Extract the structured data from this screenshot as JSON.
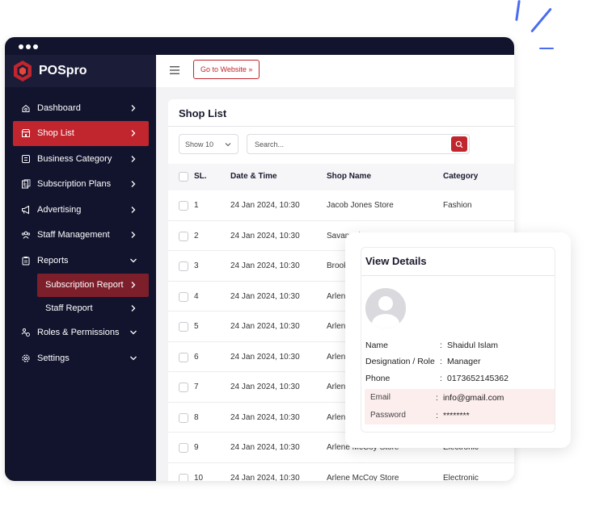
{
  "brand": {
    "name": "POSpro",
    "accent": "#c1252d"
  },
  "sidebar": {
    "items": [
      {
        "label": "Dashboard",
        "icon": "home-icon",
        "chevron": "right"
      },
      {
        "label": "Shop List",
        "icon": "store-icon",
        "chevron": "right",
        "active": true
      },
      {
        "label": "Business Category",
        "icon": "category-icon",
        "chevron": "right"
      },
      {
        "label": "Subscription Plans",
        "icon": "plans-icon",
        "chevron": "right"
      },
      {
        "label": "Advertising",
        "icon": "megaphone-icon",
        "chevron": "right"
      },
      {
        "label": "Staff Management",
        "icon": "staff-icon",
        "chevron": "right"
      },
      {
        "label": "Reports",
        "icon": "clipboard-icon",
        "chevron": "down"
      },
      {
        "label": "Subscription Report",
        "sub": true,
        "chevron": "right",
        "active": true
      },
      {
        "label": "Staff Report",
        "sub": true,
        "chevron": "right"
      },
      {
        "label": "Roles & Permissions",
        "icon": "roles-icon",
        "chevron": "down"
      },
      {
        "label": "Settings",
        "icon": "gear-icon",
        "chevron": "down"
      }
    ]
  },
  "topbar": {
    "goto_label": "Go to Website »"
  },
  "shop_list": {
    "title": "Shop List",
    "show_select": "Show 10",
    "search_placeholder": "Search...",
    "columns": [
      "SL.",
      "Date & Time",
      "Shop Name",
      "Category"
    ],
    "rows": [
      {
        "sl": "1",
        "date": "24 Jan 2024, 10:30",
        "shop": "Jacob Jones Store",
        "category": "Fashion"
      },
      {
        "sl": "2",
        "date": "24 Jan 2024, 10:30",
        "shop": "Savannah Nguyen",
        "category": ""
      },
      {
        "sl": "3",
        "date": "24 Jan 2024, 10:30",
        "shop": "Brooklyn Simmons",
        "category": ""
      },
      {
        "sl": "4",
        "date": "24 Jan 2024, 10:30",
        "shop": "Arlene McCoy Store",
        "category": ""
      },
      {
        "sl": "5",
        "date": "24 Jan 2024, 10:30",
        "shop": "Arlene McCoy Store",
        "category": ""
      },
      {
        "sl": "6",
        "date": "24 Jan 2024, 10:30",
        "shop": "Arlene McCoy Store",
        "category": ""
      },
      {
        "sl": "7",
        "date": "24 Jan 2024, 10:30",
        "shop": "Arlene McCoy Store",
        "category": ""
      },
      {
        "sl": "8",
        "date": "24 Jan 2024, 10:30",
        "shop": "Arlene McCoy Store",
        "category": ""
      },
      {
        "sl": "9",
        "date": "24 Jan 2024, 10:30",
        "shop": "Arlene McCoy Store",
        "category": "Electronic"
      },
      {
        "sl": "10",
        "date": "24 Jan 2024, 10:30",
        "shop": "Arlene McCoy Store",
        "category": "Electronic"
      }
    ]
  },
  "details": {
    "title": "View Details",
    "fields": [
      {
        "label": "Name",
        "value": "Shaidul Islam"
      },
      {
        "label": "Designation / Role",
        "value": "Manager"
      },
      {
        "label": "Phone",
        "value": "0173652145362"
      },
      {
        "label": "Email",
        "value": "info@gmail.com"
      },
      {
        "label": "Password",
        "value": "********"
      }
    ]
  }
}
